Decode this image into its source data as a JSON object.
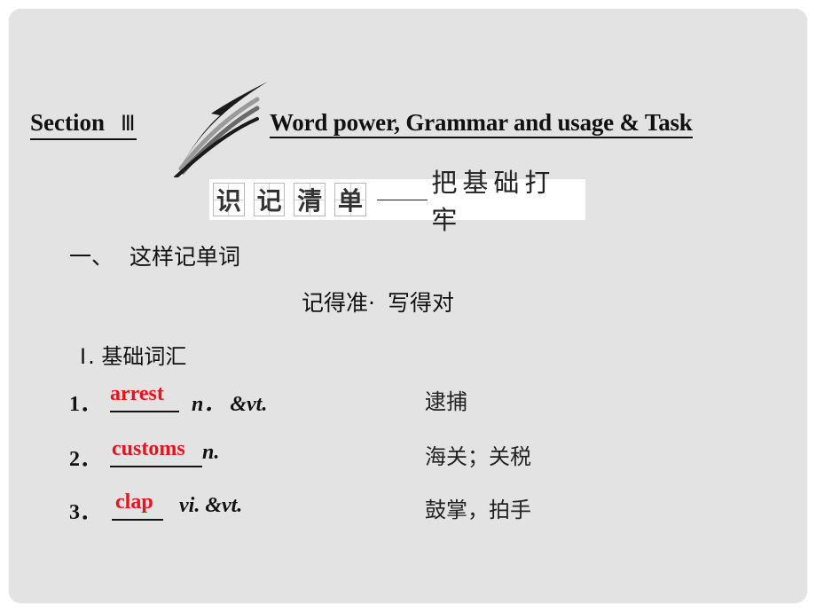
{
  "title": {
    "section_label": "Section",
    "section_numeral": "Ⅲ",
    "subtitle": "Word power, Grammar and usage & Task"
  },
  "banner": {
    "boxed_chars": [
      "识",
      "记",
      "清",
      "单"
    ],
    "tail": "把基础打牢"
  },
  "section_one": {
    "number": "一、",
    "title": "这样记单词"
  },
  "subheading": {
    "part1": "记得准·",
    "part2": "写得对"
  },
  "section_two": {
    "numeral": "Ⅰ",
    "title": ". 基础词汇"
  },
  "vocab": [
    {
      "index": "1．",
      "answer": "arrest",
      "pos": "n．  &vt.",
      "meaning": "逮捕"
    },
    {
      "index": "2．",
      "answer": "customs",
      "pos": "n.",
      "meaning": "海关；关税"
    },
    {
      "index": "3．",
      "answer": "clap",
      "pos": "vi. &vt.",
      "meaning": "鼓掌，拍手"
    }
  ],
  "colors": {
    "answer": "#e8141a",
    "slide_bg": "#e3e3e3"
  }
}
